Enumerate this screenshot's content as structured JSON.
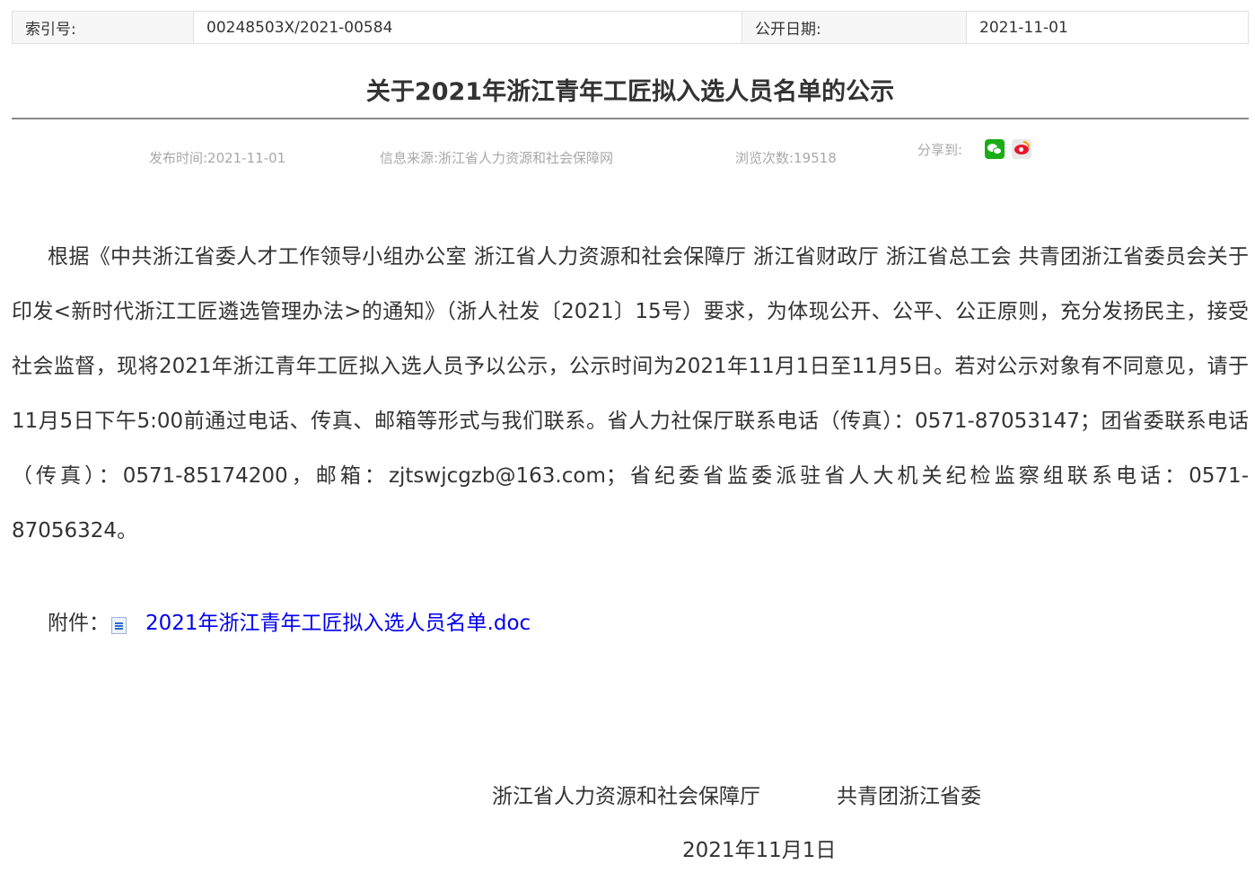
{
  "meta": {
    "index_label": "索引号:",
    "index_value": "00248503X/2021-00584",
    "date_label": "公开日期:",
    "date_value": "2021-11-01"
  },
  "article": {
    "title": "关于2021年浙江青年工匠拟入选人员名单的公示",
    "publish_time": "发布时间:2021-11-01",
    "source": "信息来源:浙江省人力资源和社会保障网",
    "views": "浏览次数:19518",
    "share_label": "分享到:",
    "share_icons": [
      "wechat-icon",
      "weibo-icon"
    ],
    "body": "根据《中共浙江省委人才工作领导小组办公室 浙江省人力资源和社会保障厅 浙江省财政厅 浙江省总工会 共青团浙江省委员会关于印发<新时代浙江工匠遴选管理办法>的通知》（浙人社发〔2021〕15号）要求，为体现公开、公平、公正原则，充分发扬民主，接受社会监督，现将2021年浙江青年工匠拟入选人员予以公示，公示时间为2021年11月1日至11月5日。若对公示对象有不同意见，请于11月5日下午5:00前通过电话、传真、邮箱等形式与我们联系。省人力社保厅联系电话（传真）：0571-87053147；团省委联系电话（传真）：0571-85174200，邮箱：zjtswjcgzb@163.com；省纪委省监委派驻省人大机关纪检监察组联系电话：0571-87056324。",
    "attachment_label": "附件：",
    "attachment_link": "2021年浙江青年工匠拟入选人员名单.doc",
    "signer_1": "浙江省人力资源和社会保障厅",
    "signer_2": "共青团浙江省委",
    "sign_date": "2021年11月1日"
  },
  "colors": {
    "link": "#0000ee",
    "muted": "#a8a8a8",
    "wechat": "#1aad19",
    "weibo": "#e6162d"
  }
}
